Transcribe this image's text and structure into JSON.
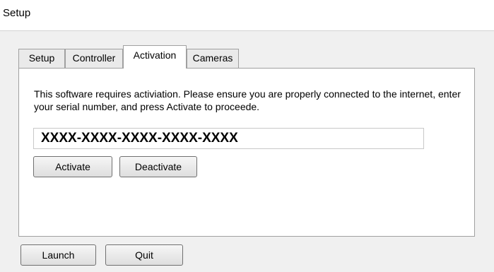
{
  "window": {
    "title": "Setup"
  },
  "tabs": [
    {
      "label": "Setup",
      "active": false
    },
    {
      "label": "Controller",
      "active": false
    },
    {
      "label": "Activation",
      "active": true
    },
    {
      "label": "Cameras",
      "active": false
    }
  ],
  "activation": {
    "description": "This software requires activiation. Please ensure you are properly connected to the internet, enter your serial number, and press Activate to proceede.",
    "serial_value": "XXXX-XXXX-XXXX-XXXX-XXXX",
    "activate_label": "Activate",
    "deactivate_label": "Deactivate"
  },
  "footer": {
    "launch_label": "Launch",
    "quit_label": "Quit"
  }
}
